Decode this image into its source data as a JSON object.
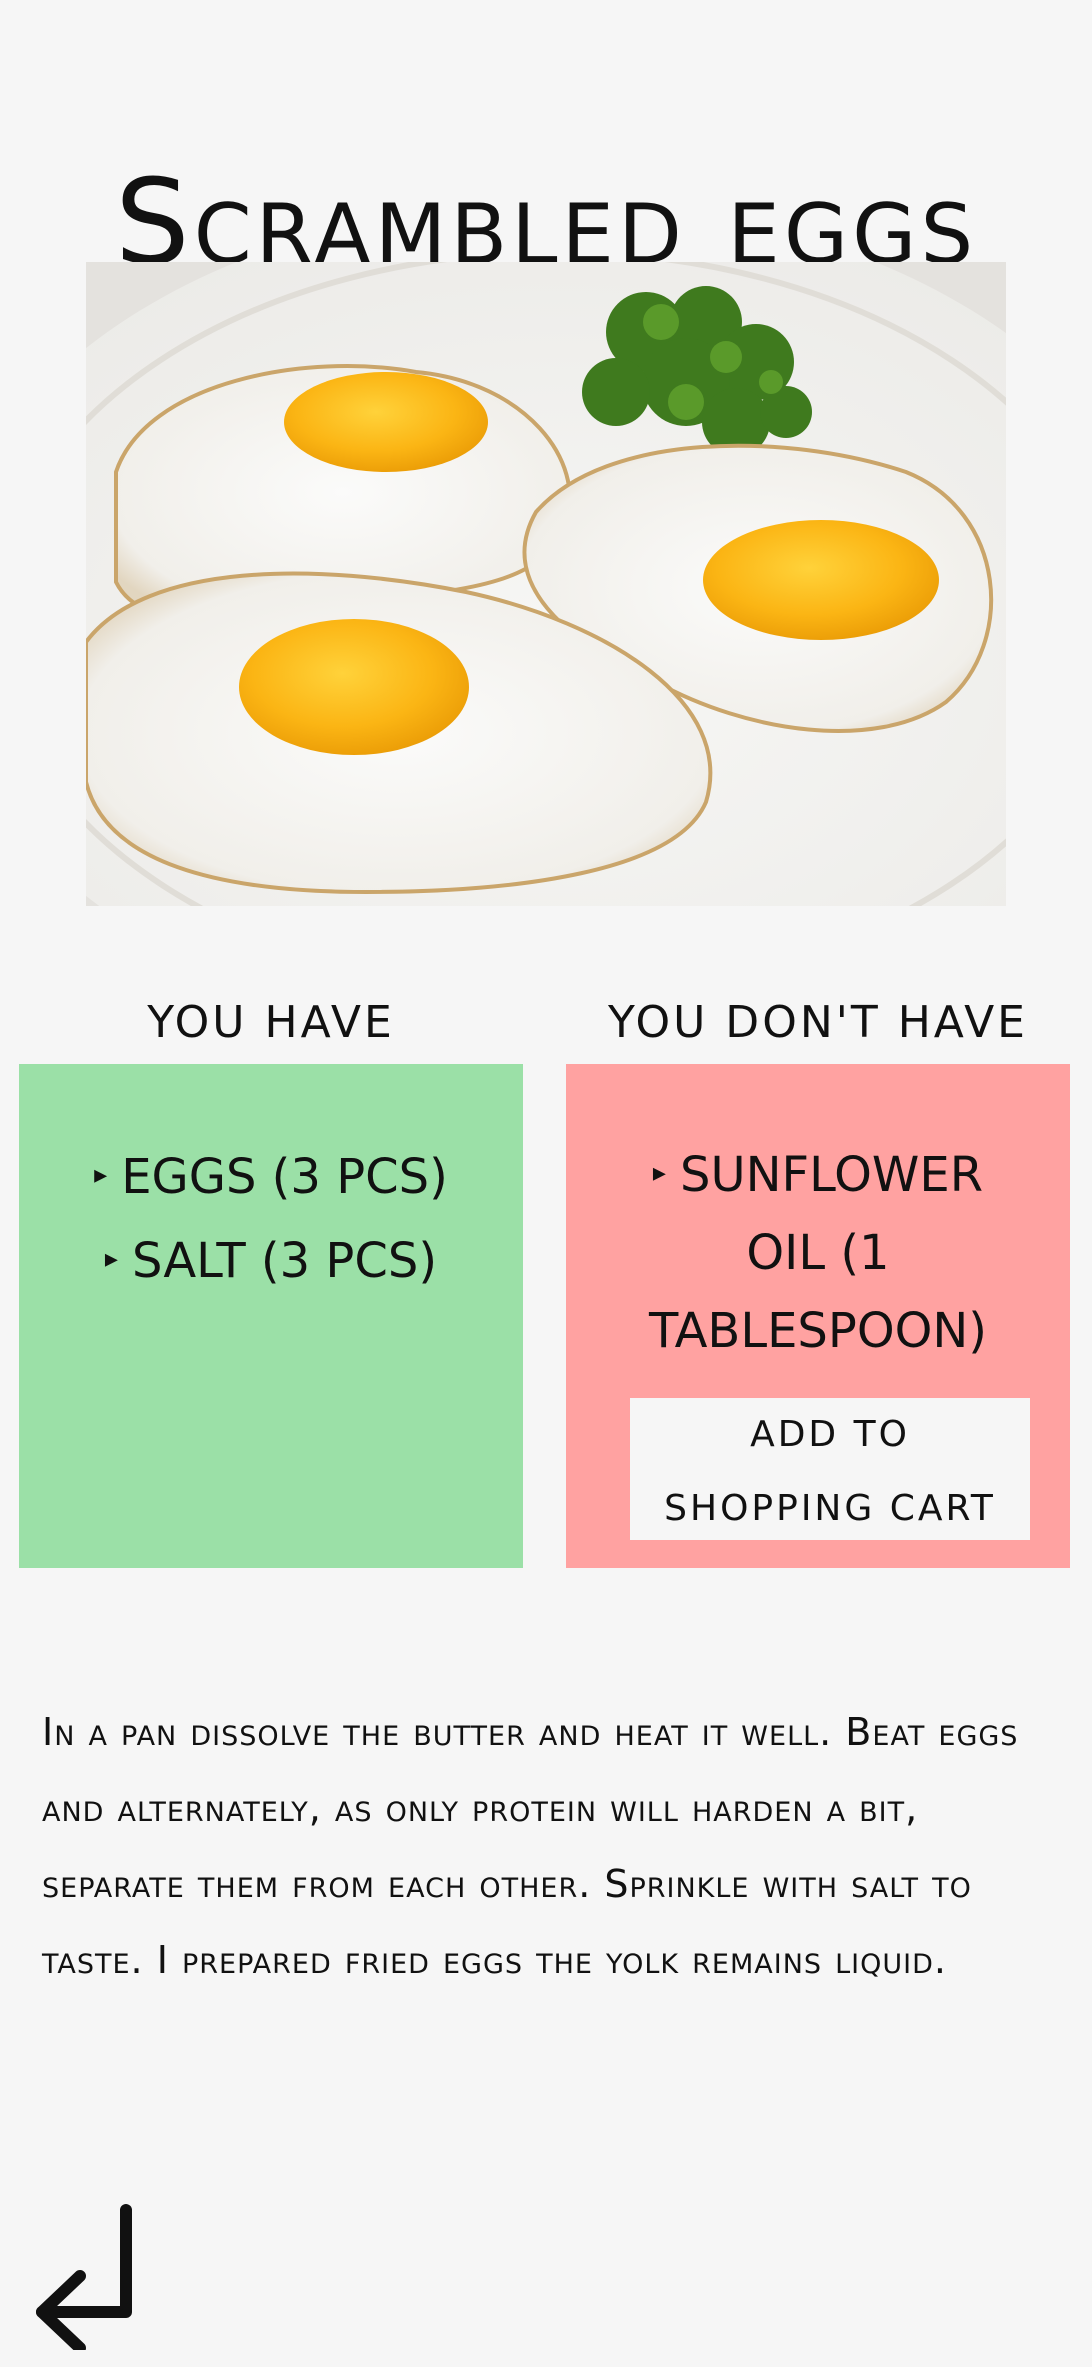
{
  "recipe": {
    "title": "Scrambled eggs",
    "image_alt": "Three fried eggs on a white plate with parsley"
  },
  "have": {
    "heading": "You have",
    "items": [
      {
        "bullet": "▸",
        "text": "Eggs (3 pcs)"
      },
      {
        "bullet": "▸",
        "text": "Salt (3 pcs)"
      }
    ]
  },
  "dont_have": {
    "heading": "You don't have",
    "items": [
      {
        "bullet": "▸",
        "text": "Sunflower oil (1 tablespoon)"
      }
    ],
    "cart_button_label": "Add to shopping cart"
  },
  "instructions": "In a pan dissolve the butter and heat it well. Beat eggs and alternately, as only protein will harden a bit, separate them from each other. Sprinkle with salt to taste. I prepared fried eggs the yolk remains liquid.",
  "nav": {
    "back_icon": "return-arrow-icon"
  },
  "colors": {
    "background": "#f6f6f6",
    "have_panel": "#9be0a7",
    "dont_have_panel": "#ffa2a1",
    "button": "#f6f6f6",
    "text": "#111111"
  }
}
